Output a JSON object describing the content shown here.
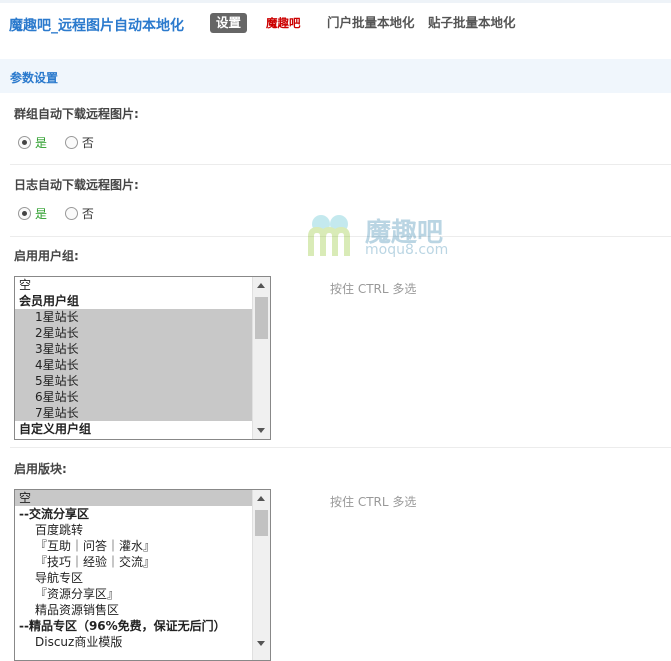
{
  "header": {
    "title": "魔趣吧_远程图片自动本地化",
    "tabs": [
      {
        "label": "设置",
        "active": true
      },
      {
        "label": "魔趣吧",
        "color": "#cc0000"
      },
      {
        "label": "门户批量本地化"
      },
      {
        "label": "贴子批量本地化"
      }
    ]
  },
  "section": {
    "title": "参数设置"
  },
  "settings": {
    "group_download": {
      "label": "群组自动下载远程图片:",
      "yes": "是",
      "no": "否",
      "value": "是"
    },
    "blog_download": {
      "label": "日志自动下载远程图片:",
      "yes": "是",
      "no": "否",
      "value": "是"
    },
    "user_groups": {
      "label": "启用用户组:",
      "hint": "按住 CTRL 多选",
      "options": [
        {
          "text": "空",
          "type": "item"
        },
        {
          "text": "会员用户组",
          "type": "group"
        },
        {
          "text": "1星站长",
          "type": "indent",
          "selected": true
        },
        {
          "text": "2星站长",
          "type": "indent",
          "selected": true
        },
        {
          "text": "3星站长",
          "type": "indent",
          "selected": true
        },
        {
          "text": "4星站长",
          "type": "indent",
          "selected": true
        },
        {
          "text": "5星站长",
          "type": "indent",
          "selected": true
        },
        {
          "text": "6星站长",
          "type": "indent",
          "selected": true
        },
        {
          "text": "7星站长",
          "type": "indent",
          "selected": true
        },
        {
          "text": "自定义用户组",
          "type": "group"
        }
      ]
    },
    "forums": {
      "label": "启用版块:",
      "hint": "按住 CTRL 多选",
      "options": [
        {
          "text": "空",
          "type": "item",
          "selected": true
        },
        {
          "text": "--交流分享区",
          "type": "group"
        },
        {
          "text": "百度跳转",
          "type": "indent"
        },
        {
          "text": "『互助｜问答｜灌水』",
          "type": "indent"
        },
        {
          "text": "『技巧｜经验｜交流』",
          "type": "indent"
        },
        {
          "text": "导航专区",
          "type": "indent"
        },
        {
          "text": "『资源分享区』",
          "type": "indent"
        },
        {
          "text": "精品资源销售区",
          "type": "indent"
        },
        {
          "text": "--精品专区（96%免费，保证无后门）",
          "type": "group"
        },
        {
          "text": "Discuz商业模版",
          "type": "indent"
        }
      ]
    }
  },
  "watermark": {
    "text": "魔趣吧",
    "sub": "moqu8.com"
  }
}
